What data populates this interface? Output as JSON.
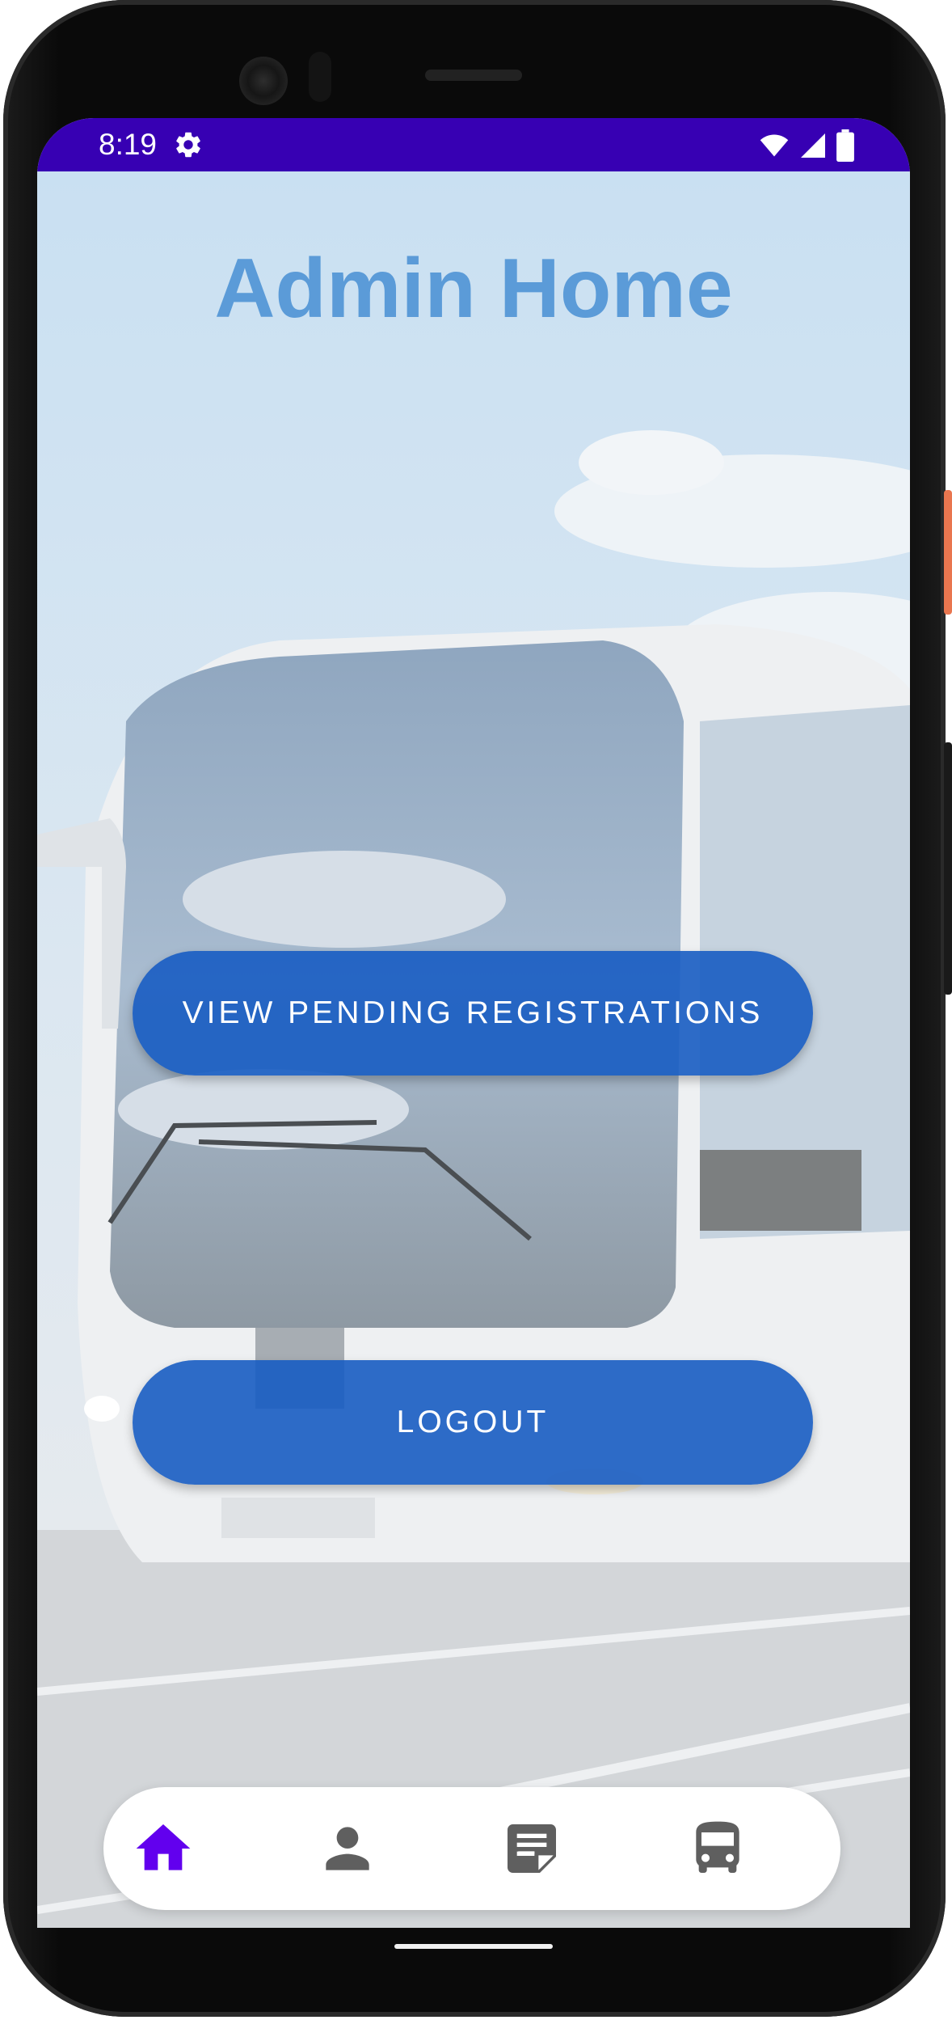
{
  "status_bar": {
    "time": "8:19",
    "background_color": "#3700b3",
    "icons": [
      "settings-gear-icon",
      "wifi-icon",
      "cellular-signal-icon",
      "battery-icon"
    ]
  },
  "page": {
    "title": "Admin Home",
    "title_color": "#5b9bd8",
    "background_image": "white coach bus on road under sky (faded)"
  },
  "buttons": {
    "view_pending": "VIEW PENDING REGISTRATIONS",
    "logout": "LOGOUT",
    "color": "#175cc2"
  },
  "bottom_nav": {
    "items": [
      {
        "icon": "home-icon",
        "selected": true,
        "color": "#6200ee"
      },
      {
        "icon": "person-icon",
        "selected": false,
        "color": "#5f5f5f"
      },
      {
        "icon": "note-icon",
        "selected": false,
        "color": "#5f5f5f"
      },
      {
        "icon": "bus-icon",
        "selected": false,
        "color": "#5f5f5f"
      }
    ]
  }
}
